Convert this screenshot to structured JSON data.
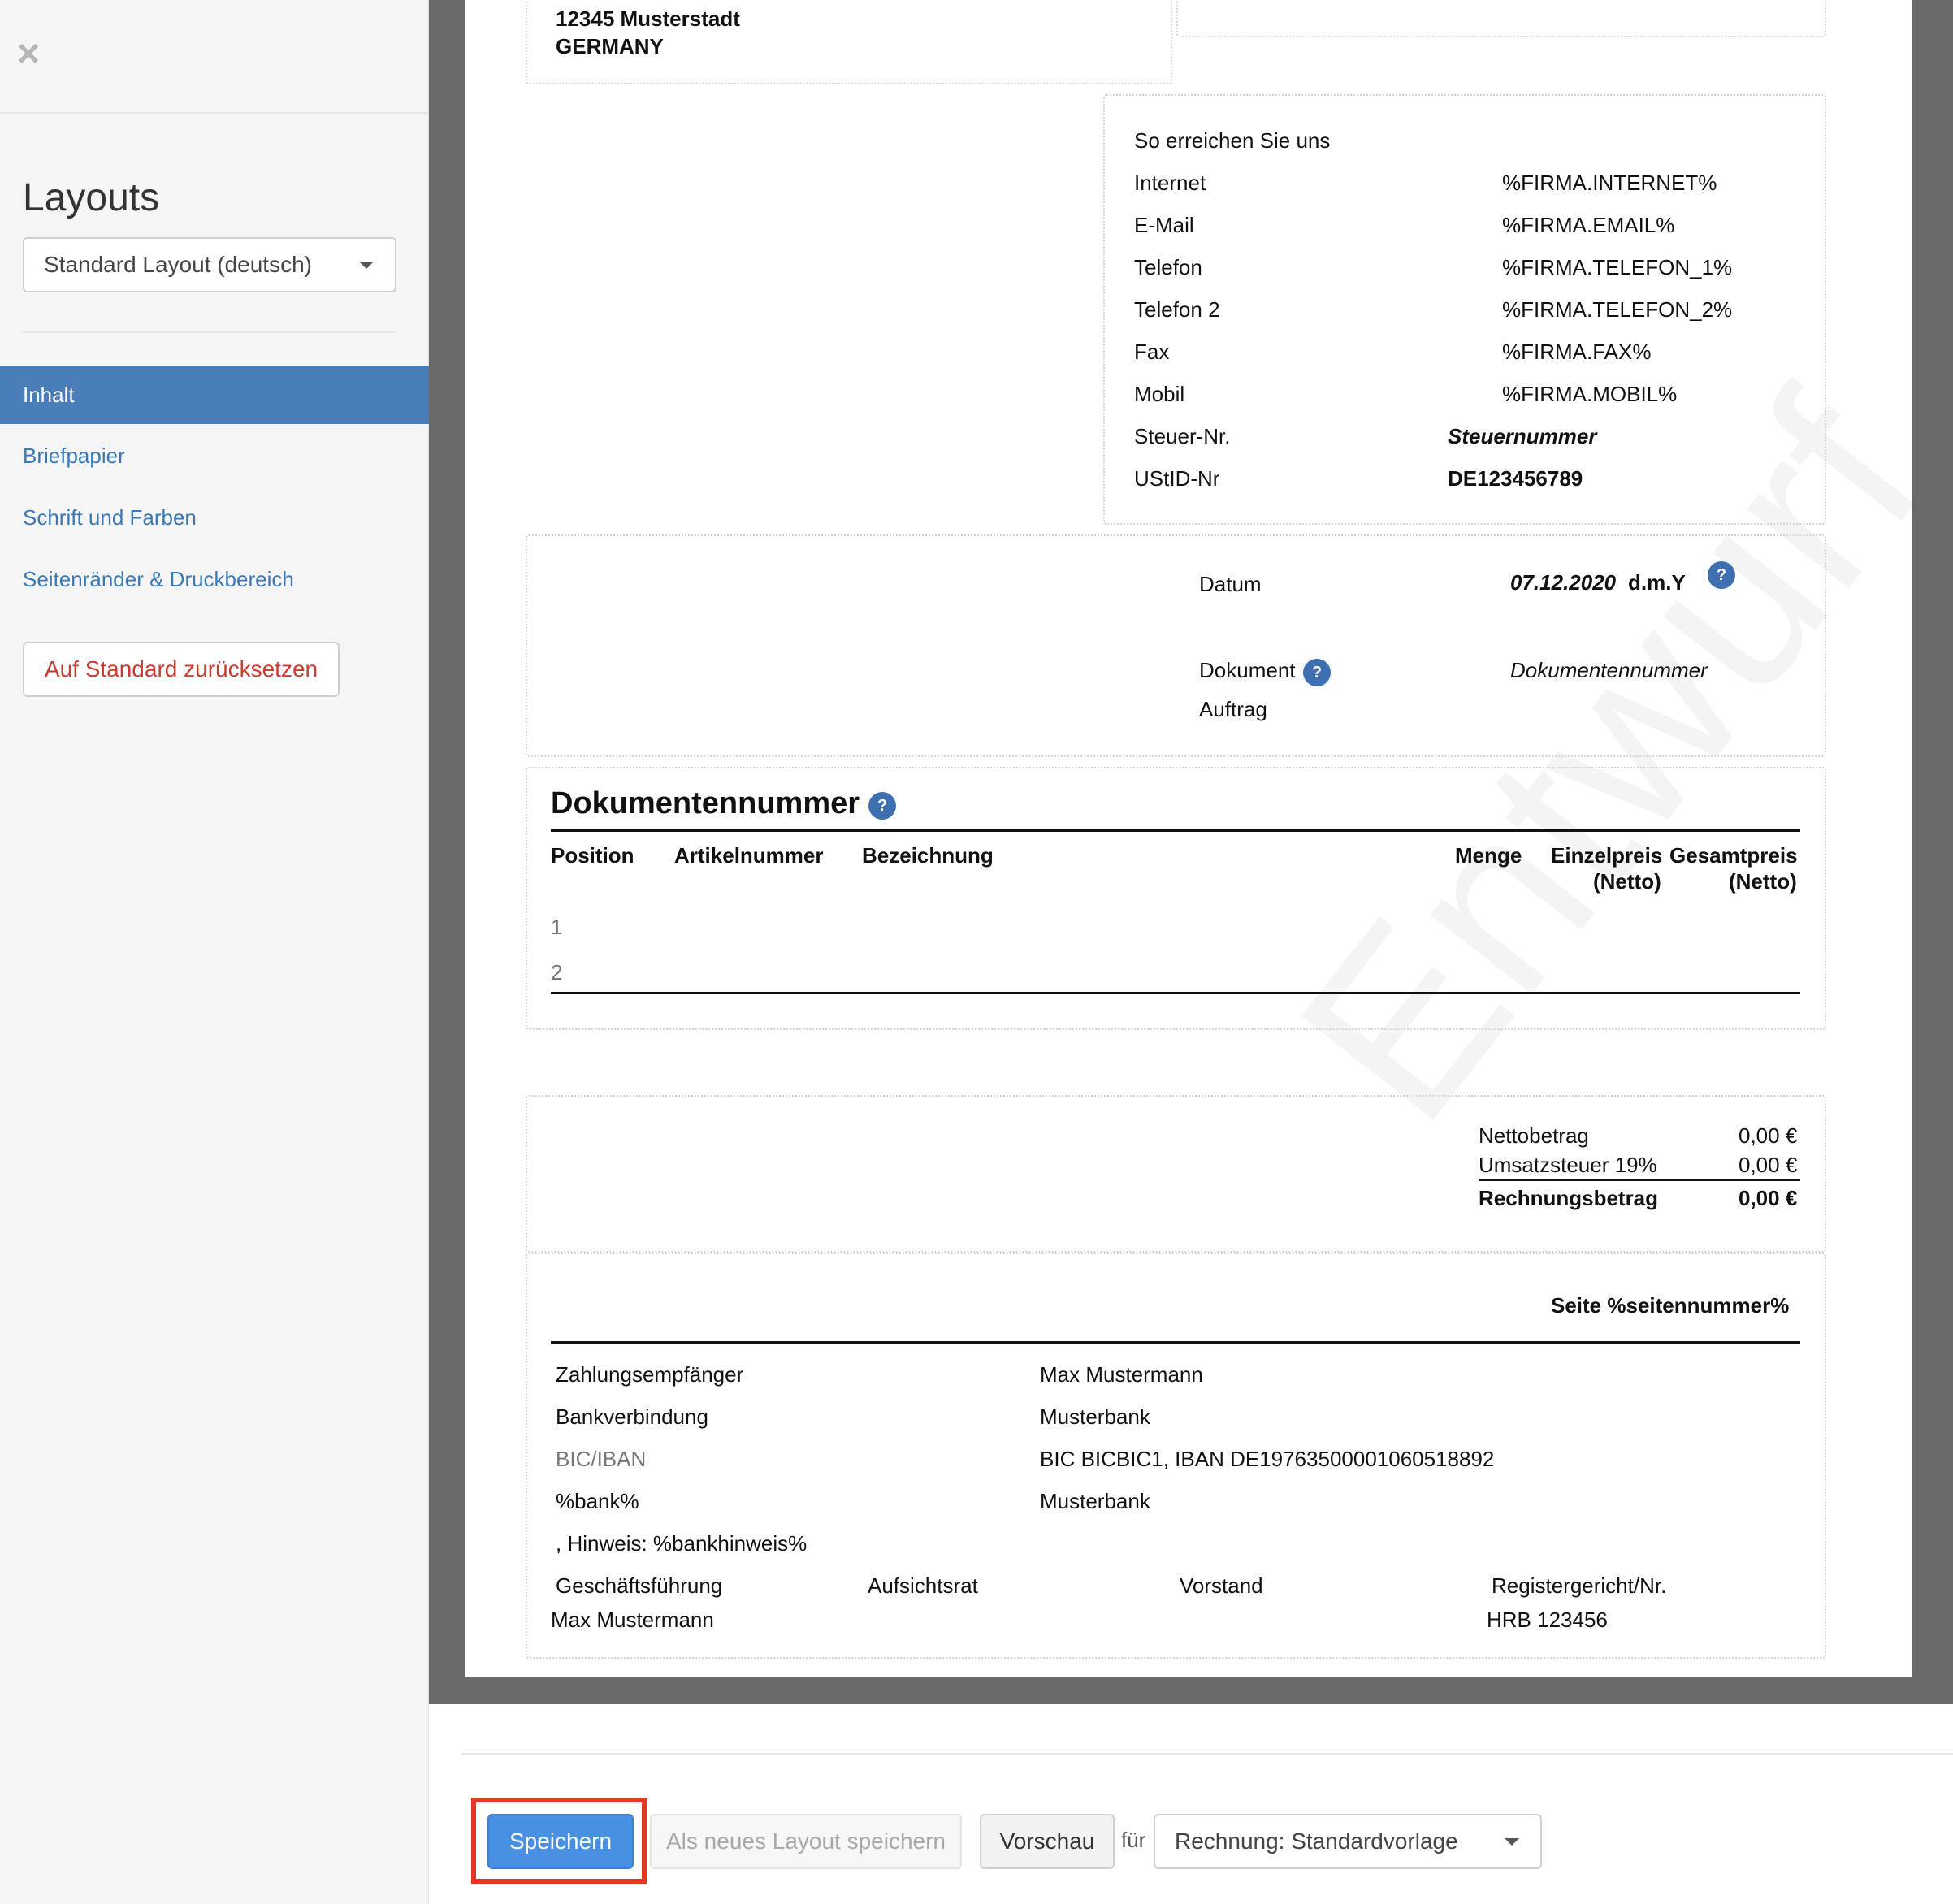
{
  "sidebar": {
    "title": "Layouts",
    "layout_select": "Standard Layout (deutsch)",
    "nav": [
      "Inhalt",
      "Briefpapier",
      "Schrift und Farben",
      "Seitenränder & Druckbereich"
    ],
    "reset_button": "Auf Standard zurücksetzen"
  },
  "address": {
    "city": "12345 Musterstadt",
    "country": "GERMANY"
  },
  "contact": {
    "heading": "So erreichen Sie uns",
    "rows": [
      {
        "label": "Internet",
        "value": "%FIRMA.INTERNET%"
      },
      {
        "label": "E-Mail",
        "value": "%FIRMA.EMAIL%"
      },
      {
        "label": "Telefon",
        "value": "%FIRMA.TELEFON_1%"
      },
      {
        "label": "Telefon 2",
        "value": "%FIRMA.TELEFON_2%"
      },
      {
        "label": "Fax",
        "value": "%FIRMA.FAX%"
      },
      {
        "label": "Mobil",
        "value": "%FIRMA.MOBIL%"
      },
      {
        "label": "Steuer-Nr.",
        "value": "Steuernummer"
      },
      {
        "label": "UStID-Nr",
        "value": "DE123456789"
      }
    ]
  },
  "meta": {
    "datum_label": "Datum",
    "datum_value": "07.12.2020",
    "datum_format": "d.m.Y",
    "dokument_label": "Dokument",
    "dokument_value": "Dokumentennummer",
    "auftrag_label": "Auftrag",
    "help": "?"
  },
  "items": {
    "title": "Dokumentennummer",
    "headers": {
      "position": "Position",
      "artikel": "Artikelnummer",
      "bezeichnung": "Bezeichnung",
      "menge": "Menge",
      "einzelpreis": "Einzelpreis",
      "gesamtpreis": "Gesamtpreis",
      "netto": "(Netto)"
    },
    "rows": [
      "1",
      "2"
    ]
  },
  "totals": {
    "netto_label": "Nettobetrag",
    "netto_value": "0,00 €",
    "ust_label": "Umsatzsteuer 19%",
    "ust_value": "0,00 €",
    "gesamt_label": "Rechnungsbetrag",
    "gesamt_value": "0,00 €"
  },
  "footer": {
    "page": "Seite %seitennummer%",
    "rows": [
      {
        "label": "Zahlungsempfänger",
        "value": "Max Mustermann"
      },
      {
        "label": "Bankverbindung",
        "value": "Musterbank"
      },
      {
        "label": "BIC/IBAN",
        "value": "BIC BICBIC1, IBAN DE19763500001060518892"
      },
      {
        "label": "%bank%",
        "value": "Musterbank"
      }
    ],
    "hinweis": ", Hinweis: %bankhinweis%",
    "gf_label": "Geschäftsführung",
    "gf_value": "Max Mustermann",
    "aufsichtsrat": "Aufsichtsrat",
    "vorstand": "Vorstand",
    "register_label": "Registergericht/Nr.",
    "register_value": "HRB 123456"
  },
  "watermark": "Entwurf",
  "toolbar": {
    "save": "Speichern",
    "save_as_new": "Als neues Layout speichern",
    "preview": "Vorschau",
    "fuer": "für",
    "template_select": "Rechnung: Standardvorlage"
  }
}
